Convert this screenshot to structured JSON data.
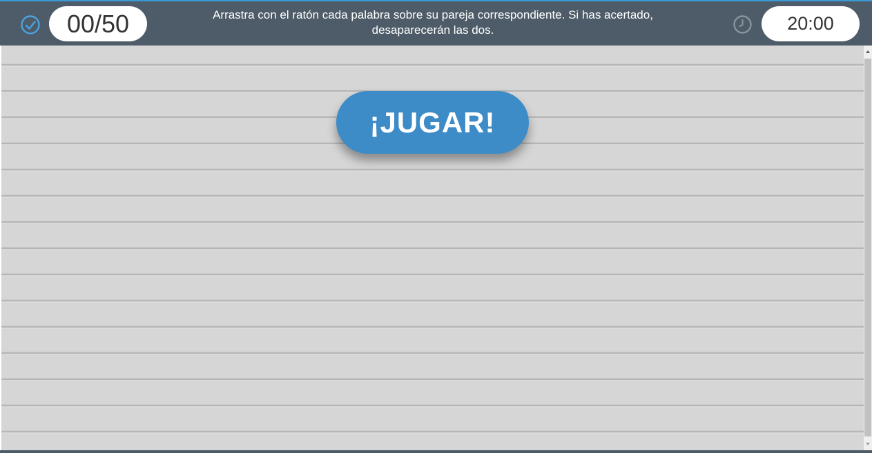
{
  "header": {
    "score": "00/50",
    "instructions": "Arrastra con el ratón cada palabra sobre su pareja correspondiente. Si has acertado, desaparecerán las dos.",
    "timer": "20:00",
    "icons": {
      "score": "check-circle-icon",
      "timer": "clock-icon"
    }
  },
  "board": {
    "play_label": "¡JUGAR!"
  },
  "colors": {
    "header_bg": "#4d5c68",
    "accent": "#3a9ad6",
    "play_button": "#3d8bc7",
    "board_bg": "#d6d6d6"
  }
}
